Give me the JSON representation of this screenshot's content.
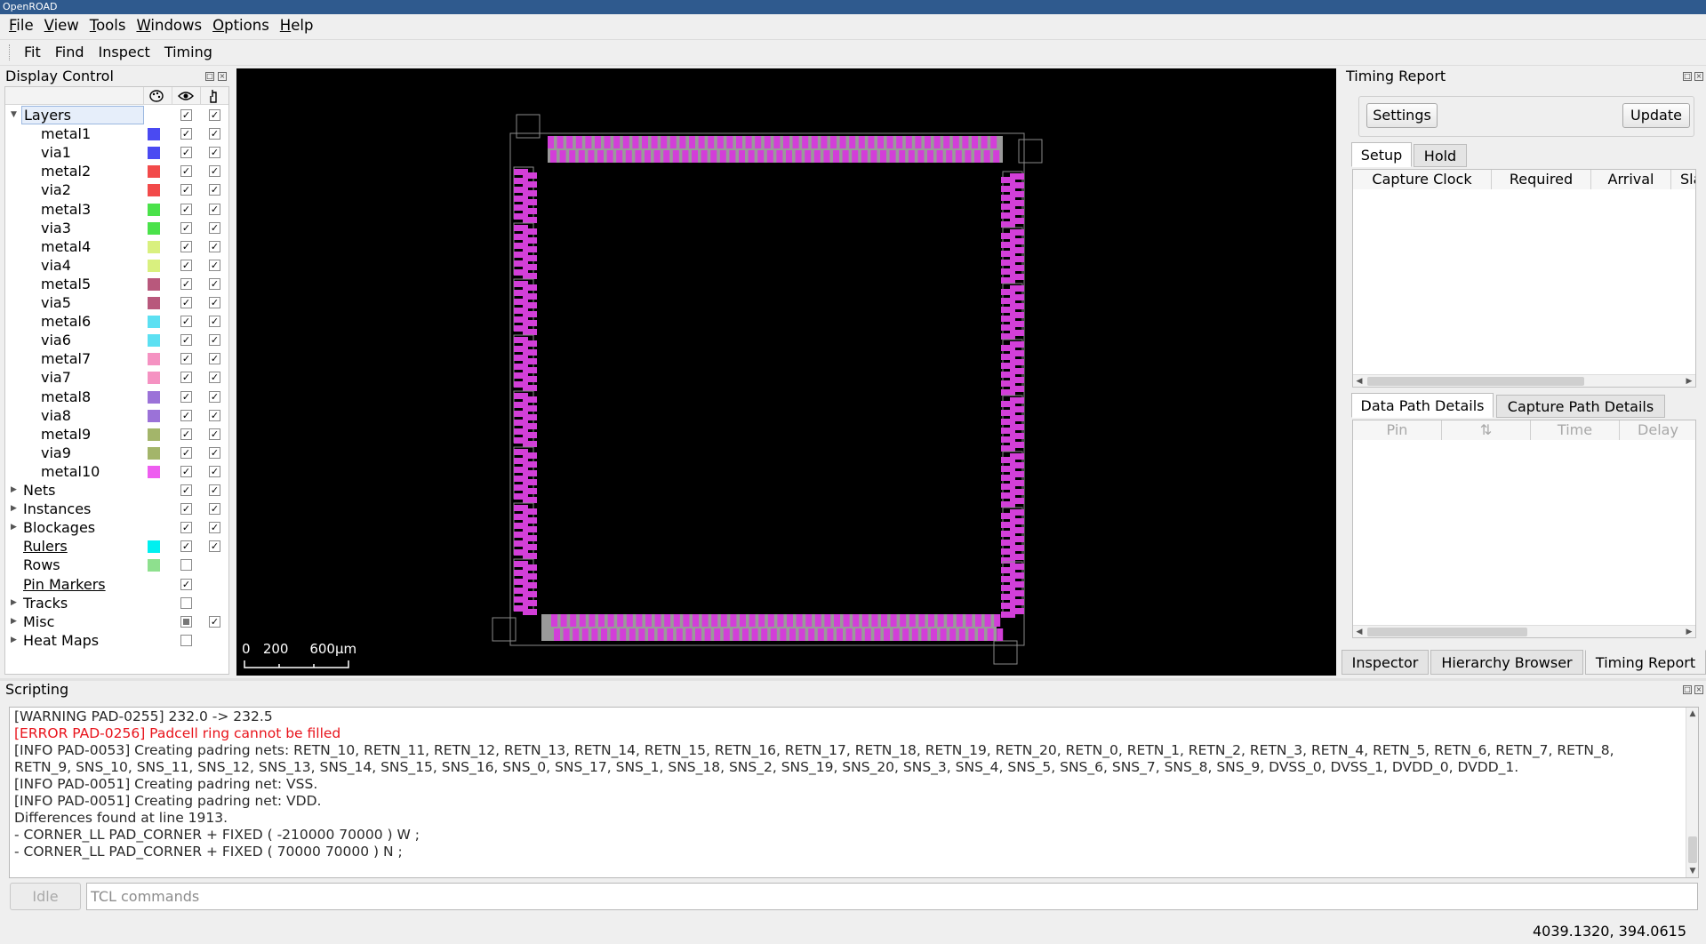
{
  "window": {
    "title": "OpenROAD"
  },
  "menu": [
    {
      "label": "File",
      "accel": "F",
      "rest": "ile"
    },
    {
      "label": "View",
      "accel": "V",
      "rest": "iew"
    },
    {
      "label": "Tools",
      "accel": "T",
      "rest": "ools"
    },
    {
      "label": "Windows",
      "accel": "W",
      "rest": "indows"
    },
    {
      "label": "Options",
      "accel": "O",
      "rest": "ptions"
    },
    {
      "label": "Help",
      "accel": "H",
      "rest": "elp"
    }
  ],
  "toolbar": {
    "fit": "Fit",
    "find": "Find",
    "inspect": "Inspect",
    "timing": "Timing"
  },
  "display_control": {
    "title": "Display Control",
    "header_icons": [
      "palette-icon",
      "eye-icon",
      "pointer-icon"
    ],
    "layers_label": "Layers",
    "layers": [
      {
        "name": "metal1",
        "color": "#4a4af2"
      },
      {
        "name": "via1",
        "color": "#4a4af2"
      },
      {
        "name": "metal2",
        "color": "#f24a4a"
      },
      {
        "name": "via2",
        "color": "#f24a4a"
      },
      {
        "name": "metal3",
        "color": "#4ae24a"
      },
      {
        "name": "via3",
        "color": "#4ae24a"
      },
      {
        "name": "metal4",
        "color": "#d9f07f"
      },
      {
        "name": "via4",
        "color": "#d9f07f"
      },
      {
        "name": "metal5",
        "color": "#b8587c"
      },
      {
        "name": "via5",
        "color": "#b8587c"
      },
      {
        "name": "metal6",
        "color": "#5ce0f2"
      },
      {
        "name": "via6",
        "color": "#5ce0f2"
      },
      {
        "name": "metal7",
        "color": "#f592c2"
      },
      {
        "name": "via7",
        "color": "#f592c2"
      },
      {
        "name": "metal8",
        "color": "#9b72d8"
      },
      {
        "name": "via8",
        "color": "#9b72d8"
      },
      {
        "name": "metal9",
        "color": "#a3b56a"
      },
      {
        "name": "via9",
        "color": "#a3b56a"
      },
      {
        "name": "metal10",
        "color": "#ee5df0"
      }
    ],
    "groups": [
      {
        "label": "Nets",
        "expandable": true,
        "visible": "checked",
        "selectable": "checked"
      },
      {
        "label": "Instances",
        "expandable": true,
        "visible": "checked",
        "selectable": "checked"
      },
      {
        "label": "Blockages",
        "expandable": true,
        "visible": "checked",
        "selectable": "checked"
      },
      {
        "label": "Rulers",
        "expandable": false,
        "underline": true,
        "color": "#00f0f0",
        "visible": "checked",
        "selectable": "checked"
      },
      {
        "label": "Rows",
        "expandable": false,
        "color": "#8ee08e",
        "visible": "unchecked"
      },
      {
        "label": "Pin Markers",
        "expandable": false,
        "underline": true,
        "visible": "checked"
      },
      {
        "label": "Tracks",
        "expandable": true,
        "visible": "unchecked"
      },
      {
        "label": "Misc",
        "expandable": true,
        "visible": "partial",
        "selectable": "checked"
      },
      {
        "label": "Heat Maps",
        "expandable": true,
        "visible": "unchecked"
      }
    ]
  },
  "layout": {
    "scale_text": "0   200     600µm",
    "pad_color": "#d23fd8",
    "pad_fill_color": "#9a9a9a",
    "die_outline_color": "#8a8a8a"
  },
  "timing_report": {
    "title": "Timing Report",
    "settings_button": "Settings",
    "update_button": "Update",
    "tabs": [
      "Setup",
      "Hold"
    ],
    "columns": [
      "Capture Clock",
      "Required",
      "Arrival",
      "Sla"
    ],
    "detail_tabs": [
      "Data Path Details",
      "Capture Path Details"
    ],
    "detail_columns": [
      "Pin",
      "⇅",
      "Time",
      "Delay"
    ]
  },
  "bottom_tabs": [
    "Inspector",
    "Hierarchy Browser",
    "Timing Report"
  ],
  "scripting": {
    "title": "Scripting",
    "lines": [
      {
        "text": "[WARNING PAD-0255]      232.0 -> 232.5",
        "type": "normal"
      },
      {
        "text": "[ERROR PAD-0256] Padcell ring cannot be filled",
        "type": "error"
      },
      {
        "text": "[INFO PAD-0053] Creating padring nets: RETN_10, RETN_11, RETN_12, RETN_13, RETN_14, RETN_15, RETN_16, RETN_17, RETN_18, RETN_19, RETN_20, RETN_0, RETN_1, RETN_2, RETN_3, RETN_4, RETN_5, RETN_6, RETN_7, RETN_8,",
        "type": "normal"
      },
      {
        "text": "RETN_9, SNS_10, SNS_11, SNS_12, SNS_13, SNS_14, SNS_15, SNS_16, SNS_0, SNS_17, SNS_1, SNS_18, SNS_2, SNS_19, SNS_20, SNS_3, SNS_4, SNS_5, SNS_6, SNS_7, SNS_8, SNS_9, DVSS_0, DVSS_1, DVDD_0, DVDD_1.",
        "type": "normal"
      },
      {
        "text": "[INFO PAD-0051] Creating padring net: VSS.",
        "type": "normal"
      },
      {
        "text": "[INFO PAD-0051] Creating padring net: VDD.",
        "type": "normal"
      },
      {
        "text": "Differences found at line 1913.",
        "type": "normal"
      },
      {
        "text": "    - CORNER_LL PAD_CORNER + FIXED ( -210000 70000 ) W ;",
        "type": "normal"
      },
      {
        "text": "    - CORNER_LL PAD_CORNER + FIXED ( 70000 70000 ) N ;",
        "type": "normal"
      }
    ],
    "idle_label": "Idle",
    "input_placeholder": "TCL commands"
  },
  "status": {
    "coordinates": "4039.1320, 394.0615"
  }
}
